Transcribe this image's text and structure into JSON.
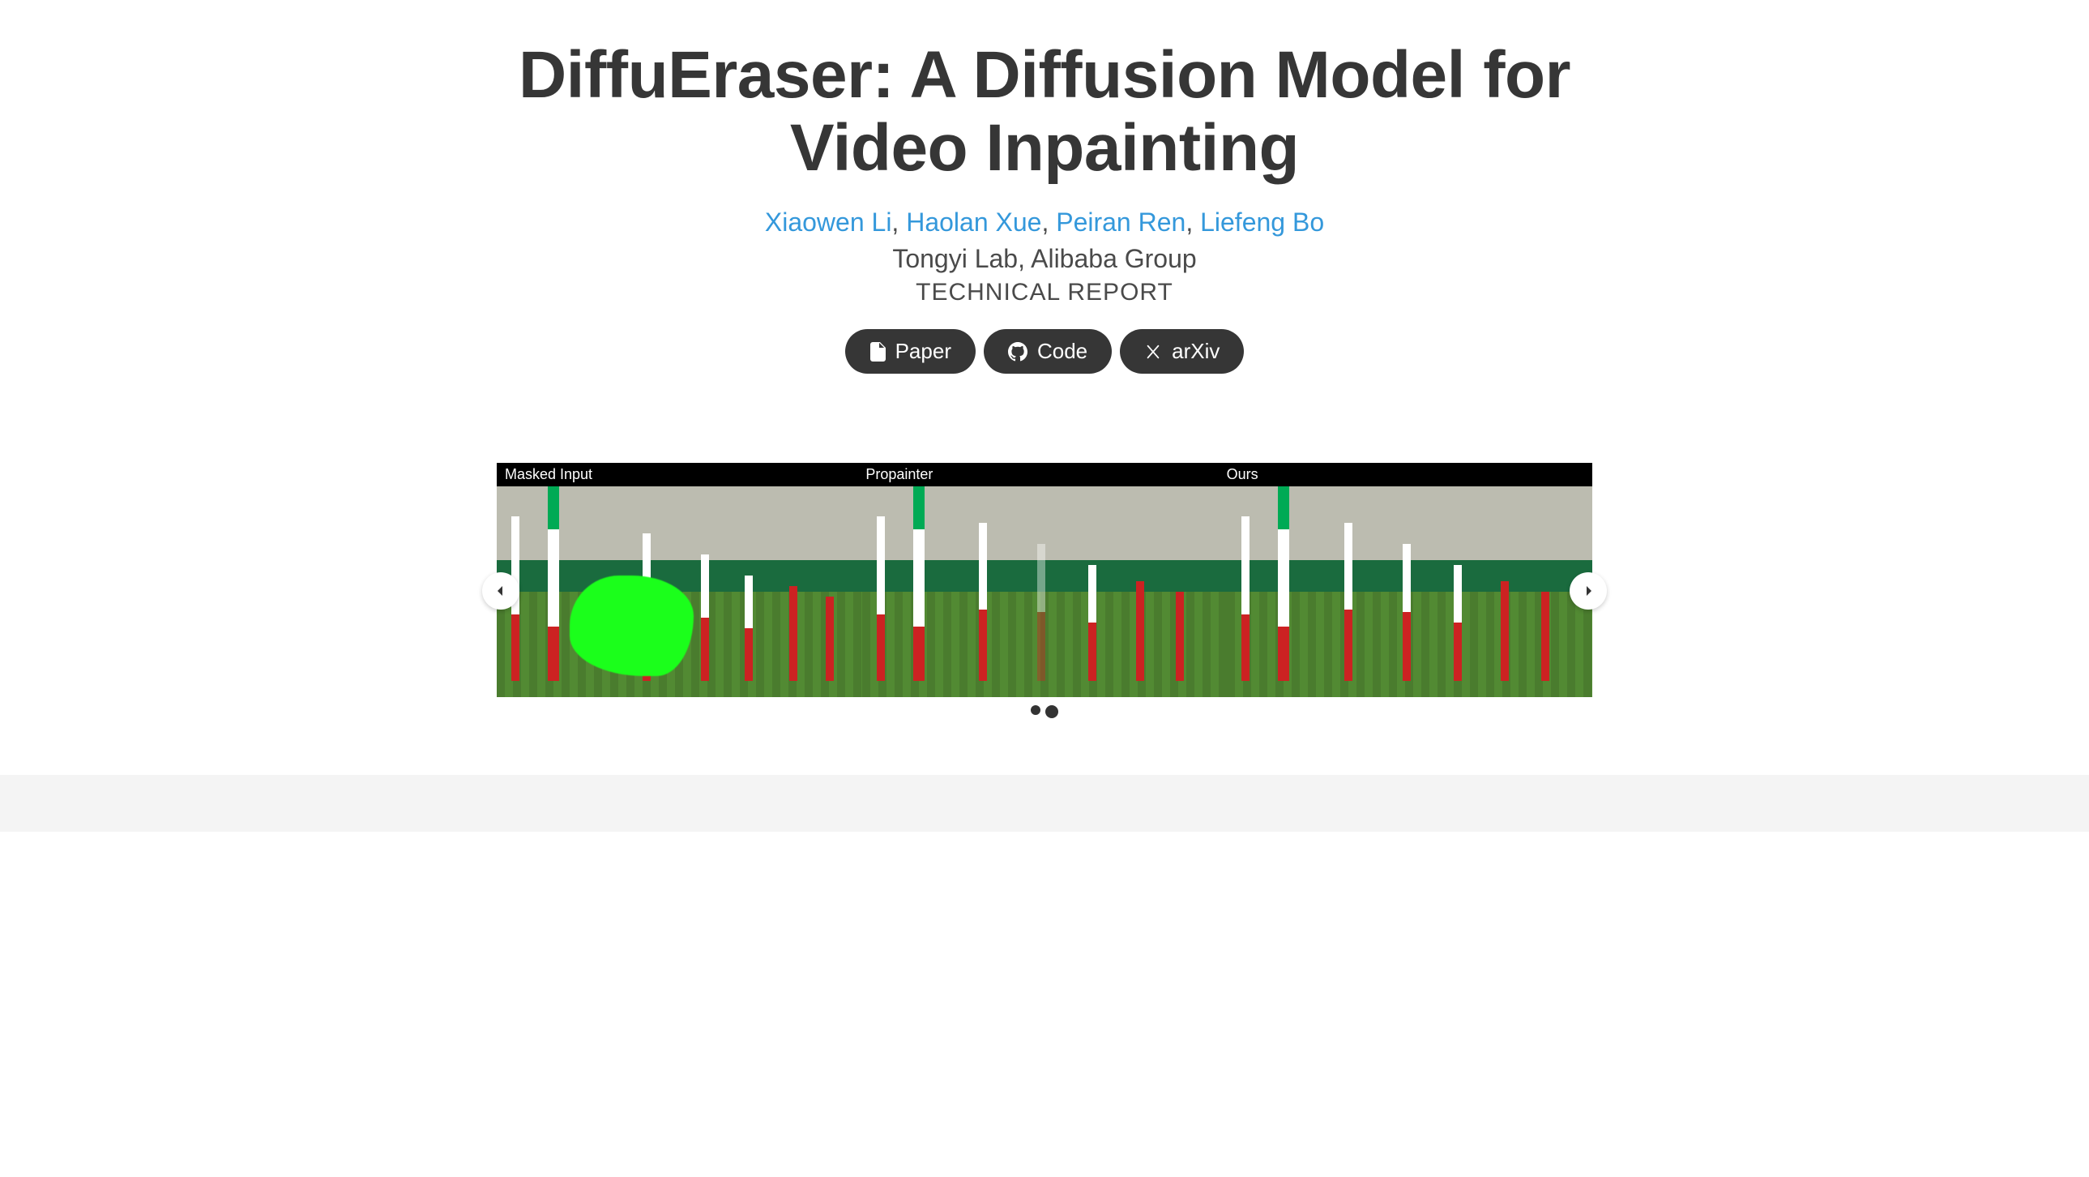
{
  "title": "DiffuEraser: A Diffusion Model for Video Inpainting",
  "authors": [
    {
      "name": "Xiaowen Li"
    },
    {
      "name": "Haolan Xue"
    },
    {
      "name": "Peiran Ren"
    },
    {
      "name": "Liefeng Bo"
    }
  ],
  "affiliation": "Tongyi Lab, Alibaba Group",
  "report_label": "TECHNICAL REPORT",
  "buttons": {
    "paper": "Paper",
    "code": "Code",
    "arxiv": "arXiv"
  },
  "carousel": {
    "labels": {
      "masked": "Masked  Input",
      "propainter": "Propainter",
      "ours": "Ours"
    },
    "dots_total": 2,
    "dots_active_index": 1
  }
}
